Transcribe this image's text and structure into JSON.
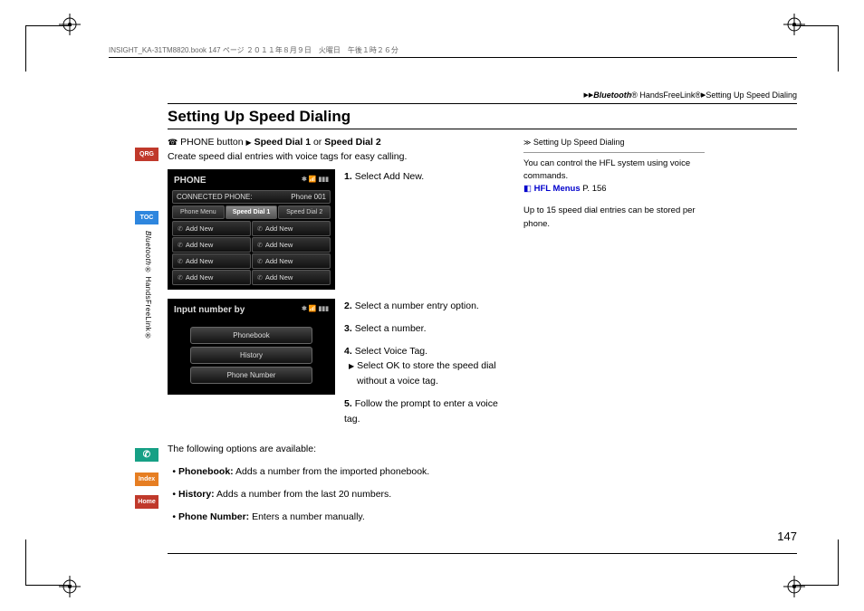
{
  "header_meta": "INSIGHT_KA-31TM8820.book  147 ページ  ２０１１年８月９日　火曜日　午後１時２６分",
  "breadcrumb": {
    "bluetooth": "Bluetooth",
    "reg": "®",
    "hfl": " HandsFreeLink®",
    "section": "Setting Up Speed Dialing"
  },
  "title": "Setting Up Speed Dialing",
  "nav": {
    "button": "PHONE button",
    "sd1": "Speed Dial 1",
    "or": " or ",
    "sd2": "Speed Dial 2"
  },
  "intro": "Create speed dial entries with voice tags for easy calling.",
  "screen1": {
    "title": "PHONE",
    "connected": "CONNECTED PHONE:",
    "phone_name": "Phone 001",
    "tabs": [
      "Phone Menu",
      "Speed Dial 1",
      "Speed Dial 2"
    ],
    "cell": "Add New"
  },
  "screen2": {
    "title": "Input number by",
    "buttons": [
      "Phonebook",
      "History",
      "Phone Number"
    ]
  },
  "steps": {
    "s1a": "1.",
    "s1b": "Select ",
    "s1c": "Add New",
    "s1d": ".",
    "s2a": "2.",
    "s2b": "Select a number entry option.",
    "s3a": "3.",
    "s3b": "Select a number.",
    "s4a": "4.",
    "s4b": "Select ",
    "s4c": "Voice Tag",
    "s4d": ".",
    "s4sub_a": "Select ",
    "s4sub_b": "OK",
    "s4sub_c": " to store the speed dial without a voice tag.",
    "s5a": "5.",
    "s5b": "Follow the prompt to enter a voice tag."
  },
  "options_intro": "The following options are available:",
  "options": [
    {
      "name": "Phonebook:",
      "desc": " Adds a number from the imported phonebook."
    },
    {
      "name": "History:",
      "desc": " Adds a number from the last 20 numbers."
    },
    {
      "name": "Phone Number:",
      "desc": " Enters a number manually."
    }
  ],
  "sidebar": {
    "heading": "Setting Up Speed Dialing",
    "text1": "You can control the HFL system using voice commands.",
    "link_label": "HFL Menus",
    "link_page": "P. 156",
    "text2": "Up to 15 speed dial entries can be stored per phone."
  },
  "page_number": "147",
  "side_tabs": {
    "qrg": "QRG",
    "toc": "TOC",
    "index": "Index",
    "home": "Home"
  },
  "side_label": {
    "bt": "Bluetooth",
    "rest": "® HandsFreeLink®"
  }
}
